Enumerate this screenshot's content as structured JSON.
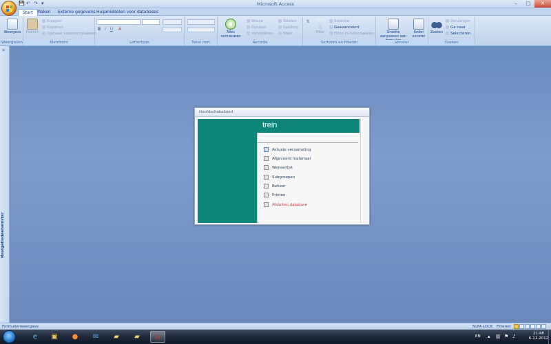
{
  "window": {
    "title": "Microsoft Access",
    "controls": {
      "minimize": "–",
      "maximize": "□",
      "close": "✕"
    }
  },
  "qat": {
    "save": "💾",
    "undo": "↶",
    "redo": "↷",
    "customize": "▾"
  },
  "ribbon": {
    "tabs": [
      {
        "label": "Start",
        "active": true
      },
      {
        "label": "Maken",
        "active": false
      },
      {
        "label": "Externe gegevens",
        "active": false
      },
      {
        "label": "Hulpmiddelen voor databases",
        "active": false
      }
    ],
    "groups": {
      "weergaven": {
        "title": "Weergaven",
        "view": "Weergave"
      },
      "klembord": {
        "title": "Klembord",
        "paste": "Plakken",
        "cut": "Knippen",
        "copy": "Kopiëren",
        "format_painter": "Opmaak kopiëren/plakken"
      },
      "lettertype": {
        "title": "Lettertype",
        "bold": "B",
        "italic": "I",
        "underline": "U",
        "color": "A"
      },
      "tekst": {
        "title": "Tekst met opmaak"
      },
      "records": {
        "title": "Records",
        "refresh": "Alles vernieuwen",
        "new": "Nieuw",
        "save": "Opslaan",
        "delete": "Verwijderen",
        "totals": "Totalen",
        "spelling": "Spelling",
        "more": "Meer"
      },
      "sorteren": {
        "title": "Sorteren en filteren",
        "filter": "Filter",
        "selection": "Selectie",
        "advanced": "Geavanceerd",
        "toggle": "Filter in-/uitschakelen"
      },
      "venster": {
        "title": "Venster",
        "fit": "Grootte aanpassen aan formulier",
        "switch": "Ander venster"
      },
      "zoeken": {
        "title": "Zoeken",
        "find": "Zoeken",
        "replace": "Vervangen",
        "goto": "Ga naar",
        "select": "Selecteren"
      }
    }
  },
  "navpane": {
    "label": "Navigatiedeelvenster",
    "toggle": "»"
  },
  "form": {
    "title": "Hoofdschakelbord",
    "heading": "trein",
    "items": [
      {
        "label": "Actuele verzameling",
        "selected": true,
        "exit": false
      },
      {
        "label": "Afgevoerd materiaal",
        "selected": false,
        "exit": false
      },
      {
        "label": "Wenserlijst",
        "selected": false,
        "exit": false
      },
      {
        "label": "Subgroepen",
        "selected": false,
        "exit": false
      },
      {
        "label": "Beheer",
        "selected": false,
        "exit": false
      },
      {
        "label": "Printen",
        "selected": false,
        "exit": false
      },
      {
        "label": "Afsluiten database",
        "selected": false,
        "exit": true
      }
    ],
    "colors": {
      "teal": "#0d8578",
      "exit": "#d03030"
    }
  },
  "statusbar": {
    "left": "Formulierweergave",
    "numlock": "NUM-LOCK",
    "filtered": "Filtered"
  },
  "taskbar": {
    "apps": [
      "ie-icon",
      "explorer-icon",
      "firefox-icon",
      "thunderbird-icon",
      "folder-icon",
      "folder-icon",
      "access-icon"
    ],
    "lang": "EN",
    "time": "21:48",
    "date": "6-11-2012"
  }
}
